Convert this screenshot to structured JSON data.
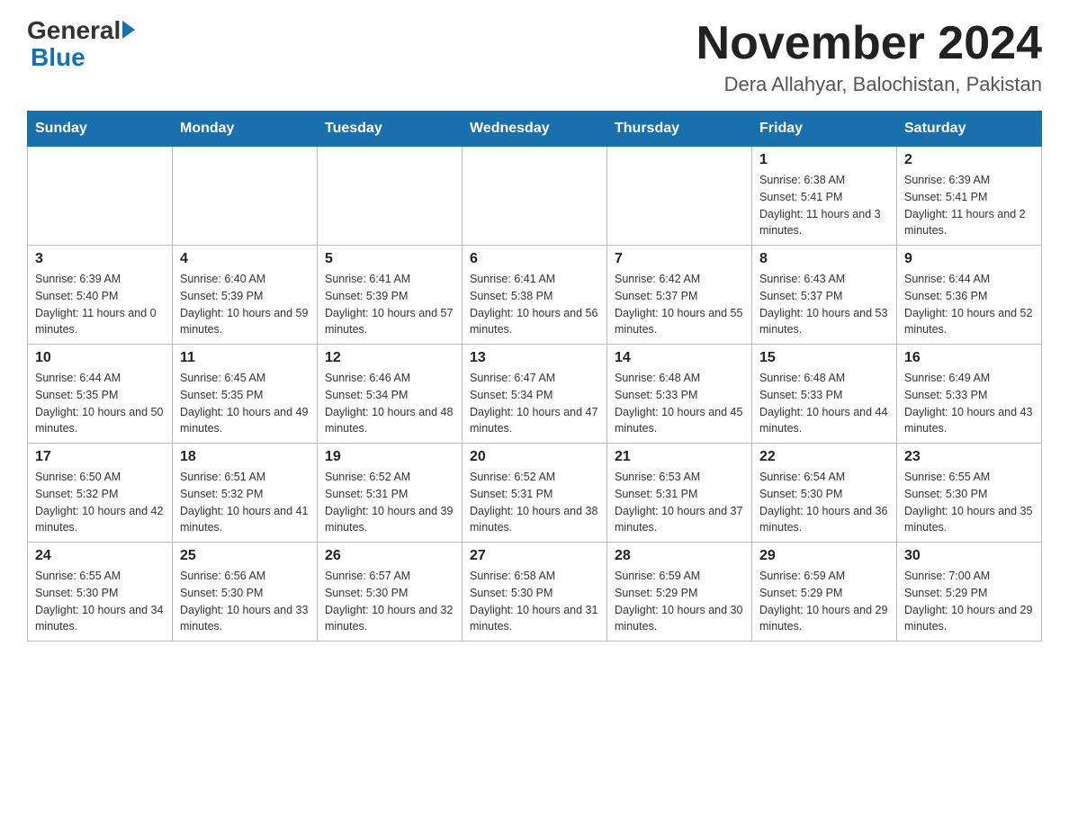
{
  "header": {
    "logo_general": "General",
    "logo_blue": "Blue",
    "month_title": "November 2024",
    "location": "Dera Allahyar, Balochistan, Pakistan"
  },
  "weekdays": [
    "Sunday",
    "Monday",
    "Tuesday",
    "Wednesday",
    "Thursday",
    "Friday",
    "Saturday"
  ],
  "weeks": [
    [
      {
        "day": "",
        "info": ""
      },
      {
        "day": "",
        "info": ""
      },
      {
        "day": "",
        "info": ""
      },
      {
        "day": "",
        "info": ""
      },
      {
        "day": "",
        "info": ""
      },
      {
        "day": "1",
        "info": "Sunrise: 6:38 AM\nSunset: 5:41 PM\nDaylight: 11 hours and 3 minutes."
      },
      {
        "day": "2",
        "info": "Sunrise: 6:39 AM\nSunset: 5:41 PM\nDaylight: 11 hours and 2 minutes."
      }
    ],
    [
      {
        "day": "3",
        "info": "Sunrise: 6:39 AM\nSunset: 5:40 PM\nDaylight: 11 hours and 0 minutes."
      },
      {
        "day": "4",
        "info": "Sunrise: 6:40 AM\nSunset: 5:39 PM\nDaylight: 10 hours and 59 minutes."
      },
      {
        "day": "5",
        "info": "Sunrise: 6:41 AM\nSunset: 5:39 PM\nDaylight: 10 hours and 57 minutes."
      },
      {
        "day": "6",
        "info": "Sunrise: 6:41 AM\nSunset: 5:38 PM\nDaylight: 10 hours and 56 minutes."
      },
      {
        "day": "7",
        "info": "Sunrise: 6:42 AM\nSunset: 5:37 PM\nDaylight: 10 hours and 55 minutes."
      },
      {
        "day": "8",
        "info": "Sunrise: 6:43 AM\nSunset: 5:37 PM\nDaylight: 10 hours and 53 minutes."
      },
      {
        "day": "9",
        "info": "Sunrise: 6:44 AM\nSunset: 5:36 PM\nDaylight: 10 hours and 52 minutes."
      }
    ],
    [
      {
        "day": "10",
        "info": "Sunrise: 6:44 AM\nSunset: 5:35 PM\nDaylight: 10 hours and 50 minutes."
      },
      {
        "day": "11",
        "info": "Sunrise: 6:45 AM\nSunset: 5:35 PM\nDaylight: 10 hours and 49 minutes."
      },
      {
        "day": "12",
        "info": "Sunrise: 6:46 AM\nSunset: 5:34 PM\nDaylight: 10 hours and 48 minutes."
      },
      {
        "day": "13",
        "info": "Sunrise: 6:47 AM\nSunset: 5:34 PM\nDaylight: 10 hours and 47 minutes."
      },
      {
        "day": "14",
        "info": "Sunrise: 6:48 AM\nSunset: 5:33 PM\nDaylight: 10 hours and 45 minutes."
      },
      {
        "day": "15",
        "info": "Sunrise: 6:48 AM\nSunset: 5:33 PM\nDaylight: 10 hours and 44 minutes."
      },
      {
        "day": "16",
        "info": "Sunrise: 6:49 AM\nSunset: 5:33 PM\nDaylight: 10 hours and 43 minutes."
      }
    ],
    [
      {
        "day": "17",
        "info": "Sunrise: 6:50 AM\nSunset: 5:32 PM\nDaylight: 10 hours and 42 minutes."
      },
      {
        "day": "18",
        "info": "Sunrise: 6:51 AM\nSunset: 5:32 PM\nDaylight: 10 hours and 41 minutes."
      },
      {
        "day": "19",
        "info": "Sunrise: 6:52 AM\nSunset: 5:31 PM\nDaylight: 10 hours and 39 minutes."
      },
      {
        "day": "20",
        "info": "Sunrise: 6:52 AM\nSunset: 5:31 PM\nDaylight: 10 hours and 38 minutes."
      },
      {
        "day": "21",
        "info": "Sunrise: 6:53 AM\nSunset: 5:31 PM\nDaylight: 10 hours and 37 minutes."
      },
      {
        "day": "22",
        "info": "Sunrise: 6:54 AM\nSunset: 5:30 PM\nDaylight: 10 hours and 36 minutes."
      },
      {
        "day": "23",
        "info": "Sunrise: 6:55 AM\nSunset: 5:30 PM\nDaylight: 10 hours and 35 minutes."
      }
    ],
    [
      {
        "day": "24",
        "info": "Sunrise: 6:55 AM\nSunset: 5:30 PM\nDaylight: 10 hours and 34 minutes."
      },
      {
        "day": "25",
        "info": "Sunrise: 6:56 AM\nSunset: 5:30 PM\nDaylight: 10 hours and 33 minutes."
      },
      {
        "day": "26",
        "info": "Sunrise: 6:57 AM\nSunset: 5:30 PM\nDaylight: 10 hours and 32 minutes."
      },
      {
        "day": "27",
        "info": "Sunrise: 6:58 AM\nSunset: 5:30 PM\nDaylight: 10 hours and 31 minutes."
      },
      {
        "day": "28",
        "info": "Sunrise: 6:59 AM\nSunset: 5:29 PM\nDaylight: 10 hours and 30 minutes."
      },
      {
        "day": "29",
        "info": "Sunrise: 6:59 AM\nSunset: 5:29 PM\nDaylight: 10 hours and 29 minutes."
      },
      {
        "day": "30",
        "info": "Sunrise: 7:00 AM\nSunset: 5:29 PM\nDaylight: 10 hours and 29 minutes."
      }
    ]
  ]
}
